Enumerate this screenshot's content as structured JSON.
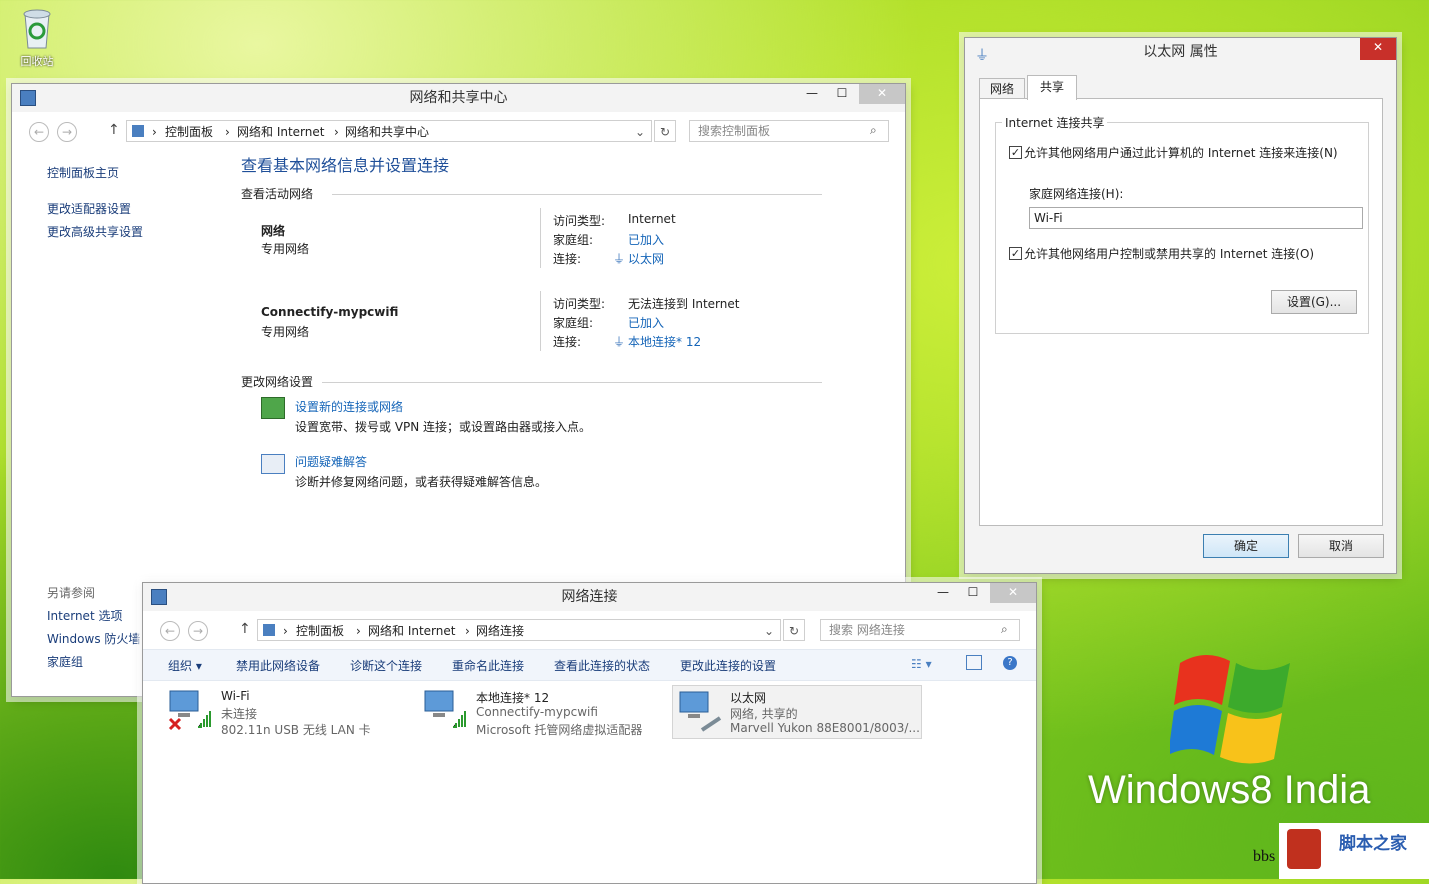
{
  "desktop": {
    "recycle_bin_label": "回收站",
    "logo_text": "Windows8 India",
    "corner_text": "bbs",
    "corner_brand": "脚本之家"
  },
  "sharing_center": {
    "title": "网络和共享中心",
    "breadcrumb": [
      "控制面板",
      "网络和 Internet",
      "网络和共享中心"
    ],
    "search_placeholder": "搜索控制面板",
    "sidebar": [
      "控制面板主页",
      "更改适配器设置",
      "更改高级共享设置"
    ],
    "see_also_title": "另请参阅",
    "see_also": [
      "Internet 选项",
      "Windows 防火墙",
      "家庭组"
    ],
    "heading": "查看基本网络信息并设置连接",
    "active_title": "查看活动网络",
    "networks": [
      {
        "name": "网络",
        "type": "专用网络",
        "access_label": "访问类型:",
        "access": "Internet",
        "home_label": "家庭组:",
        "home": "已加入",
        "conn_label": "连接:",
        "conn": "以太网"
      },
      {
        "name": "Connectify-mypcwifi",
        "type": "专用网络",
        "access_label": "访问类型:",
        "access": "无法连接到 Internet",
        "home_label": "家庭组:",
        "home": "已加入",
        "conn_label": "连接:",
        "conn": "本地连接* 12"
      }
    ],
    "change_title": "更改网络设置",
    "tasks": [
      {
        "title": "设置新的连接或网络",
        "desc": "设置宽带、拨号或 VPN 连接；或设置路由器或接入点。"
      },
      {
        "title": "问题疑难解答",
        "desc": "诊断并修复网络问题，或者获得疑难解答信息。"
      }
    ]
  },
  "properties": {
    "title": "以太网 属性",
    "tabs": [
      "网络",
      "共享"
    ],
    "group_title": "Internet 连接共享",
    "check1": "允许其他网络用户通过此计算机的 Internet 连接来连接(N)",
    "home_label": "家庭网络连接(H):",
    "home_value": "Wi-Fi",
    "check2": "允许其他网络用户控制或禁用共享的 Internet 连接(O)",
    "settings_btn": "设置(G)...",
    "ok": "确定",
    "cancel": "取消"
  },
  "connections": {
    "title": "网络连接",
    "breadcrumb": [
      "控制面板",
      "网络和 Internet",
      "网络连接"
    ],
    "search_placeholder": "搜索 网络连接",
    "toolbar": [
      "组织 ▾",
      "禁用此网络设备",
      "诊断这个连接",
      "重命名此连接",
      "查看此连接的状态",
      "更改此连接的设置"
    ],
    "items": [
      {
        "name": "Wi-Fi",
        "status": "未连接",
        "device": "802.11n USB 无线 LAN 卡"
      },
      {
        "name": "本地连接* 12",
        "status": "Connectify-mypcwifi",
        "device": "Microsoft 托管网络虚拟适配器"
      },
      {
        "name": "以太网",
        "status": "网络, 共享的",
        "device": "Marvell Yukon 88E8001/8003/..."
      }
    ]
  }
}
